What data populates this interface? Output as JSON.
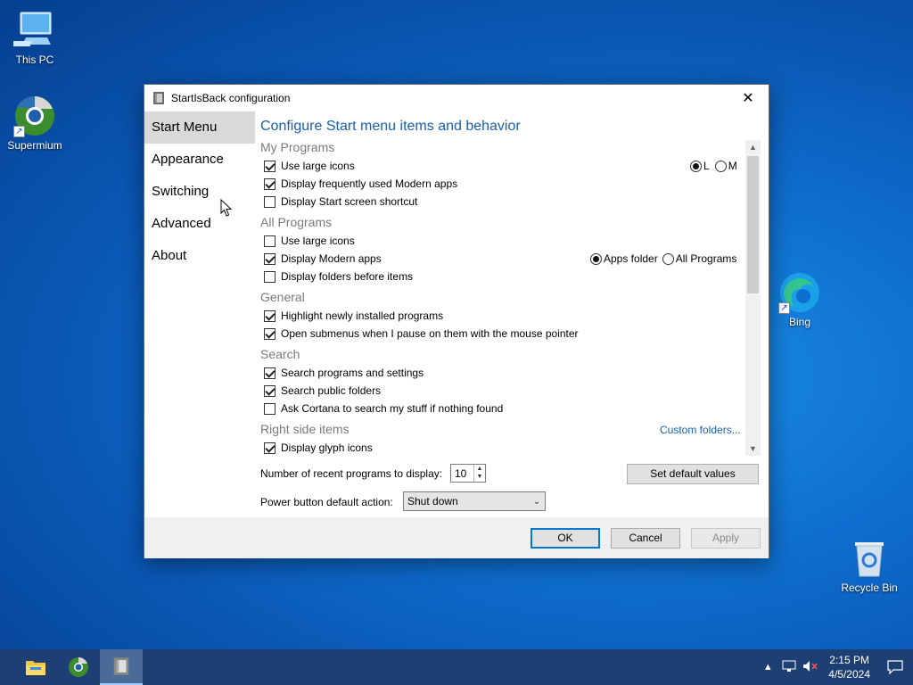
{
  "desktop": {
    "icons": [
      {
        "label": "This PC"
      },
      {
        "label": "Supermium"
      },
      {
        "label": "Bing"
      },
      {
        "label": "Recycle Bin"
      }
    ]
  },
  "window": {
    "title": "StartIsBack configuration",
    "close_glyph": "✕",
    "nav": [
      "Start Menu",
      "Appearance",
      "Switching",
      "Advanced",
      "About"
    ],
    "selected_nav": "Start Menu",
    "heading": "Configure Start menu items and behavior",
    "groups": {
      "my_programs": {
        "title": "My Programs",
        "items": [
          {
            "label": "Use large icons",
            "checked": true
          },
          {
            "label": "Display frequently used Modern apps",
            "checked": true
          },
          {
            "label": "Display Start screen shortcut",
            "checked": false
          }
        ],
        "size_options": [
          {
            "label": "L",
            "selected": true
          },
          {
            "label": "M",
            "selected": false
          }
        ]
      },
      "all_programs": {
        "title": "All Programs",
        "items": [
          {
            "label": "Use large icons",
            "checked": false
          },
          {
            "label": "Display Modern apps",
            "checked": true
          },
          {
            "label": "Display folders before items",
            "checked": false
          }
        ],
        "location_options": [
          {
            "label": "Apps folder",
            "selected": true
          },
          {
            "label": "All Programs",
            "selected": false
          }
        ]
      },
      "general": {
        "title": "General",
        "items": [
          {
            "label": "Highlight newly installed programs",
            "checked": true
          },
          {
            "label": "Open submenus when I pause on them with the mouse pointer",
            "checked": true
          }
        ]
      },
      "search": {
        "title": "Search",
        "items": [
          {
            "label": "Search programs and settings",
            "checked": true
          },
          {
            "label": "Search public folders",
            "checked": true
          },
          {
            "label": "Ask Cortana to search my stuff if nothing found",
            "checked": false
          }
        ]
      },
      "right_side": {
        "title": "Right side items",
        "custom_link": "Custom folders...",
        "items": [
          {
            "label": "Display glyph icons",
            "checked": true
          }
        ]
      }
    },
    "recent_label": "Number of recent programs to display:",
    "recent_value": "10",
    "set_default_label": "Set default values",
    "power_label": "Power button default action:",
    "power_value": "Shut down",
    "buttons": {
      "ok": "OK",
      "cancel": "Cancel",
      "apply": "Apply"
    }
  },
  "taskbar": {
    "time": "2:15 PM",
    "date": "4/5/2024",
    "tray_up_glyph": "▲"
  }
}
